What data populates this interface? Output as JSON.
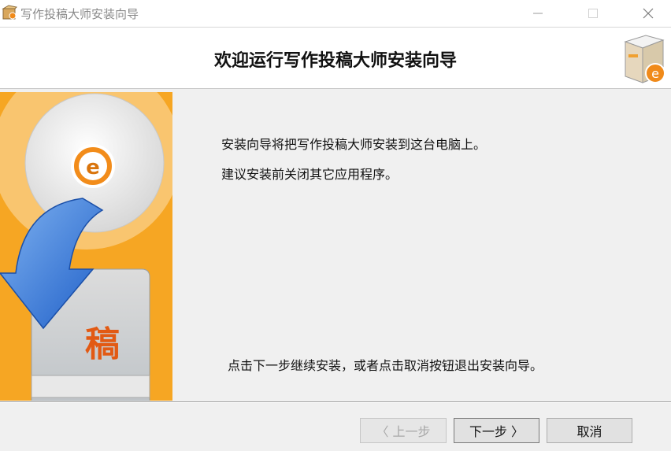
{
  "window": {
    "title": "写作投稿大师安装向导",
    "controls": {
      "minimize": "—",
      "maximize": "☐",
      "close": "✕"
    }
  },
  "header": {
    "title": "欢迎运行写作投稿大师安装向导"
  },
  "side_image": {
    "glyph": "稿",
    "accent": "#f6a623"
  },
  "content": {
    "line1": "安装向导将把写作投稿大师安装到这台电脑上。",
    "line2": "建议安装前关闭其它应用程序。",
    "line3": "点击下一步继续安装，或者点击取消按钮退出安装向导。"
  },
  "buttons": {
    "back": "〈 上一步",
    "next": "下一步 〉",
    "cancel": "取消"
  }
}
